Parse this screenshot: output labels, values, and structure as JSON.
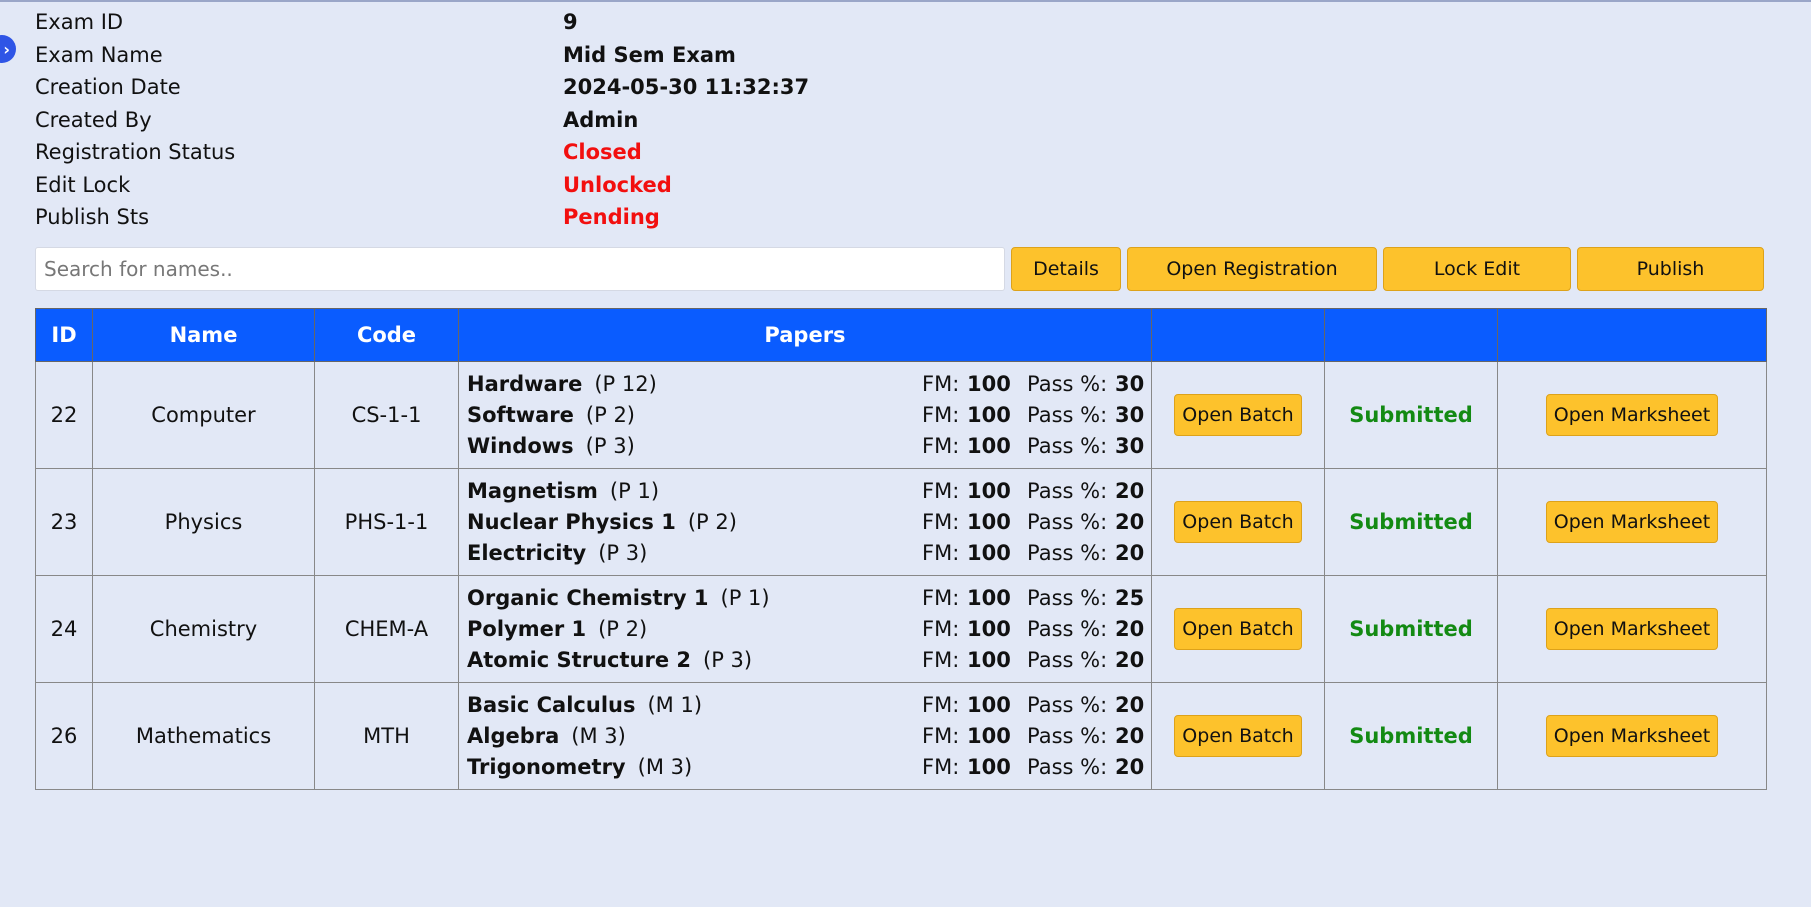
{
  "exam_info": [
    {
      "label": "Exam ID",
      "value": "9",
      "color": "#111111"
    },
    {
      "label": "Exam Name",
      "value": "Mid Sem Exam",
      "color": "#111111"
    },
    {
      "label": "Creation Date",
      "value": "2024-05-30 11:32:37",
      "color": "#111111"
    },
    {
      "label": "Created By",
      "value": "Admin",
      "color": "#111111"
    },
    {
      "label": "Registration Status",
      "value": "Closed",
      "color": "#f20f0f"
    },
    {
      "label": "Edit Lock",
      "value": "Unlocked",
      "color": "#f20f0f"
    },
    {
      "label": "Publish Sts",
      "value": "Pending",
      "color": "#f20f0f"
    }
  ],
  "search": {
    "placeholder": "Search for names.."
  },
  "toolbar": {
    "details_label": "Details",
    "open_registration_label": "Open Registration",
    "lock_edit_label": "Lock Edit",
    "publish_label": "Publish"
  },
  "table": {
    "headers": {
      "id": "ID",
      "name": "Name",
      "code": "Code",
      "papers": "Papers"
    },
    "fm_label": "FM:",
    "pass_label": "Pass %:",
    "rows": [
      {
        "id": "22",
        "name": "Computer",
        "code": "CS-1-1",
        "papers": [
          {
            "name": "Hardware",
            "code": "(P 12)",
            "fm": "100",
            "pass": "30"
          },
          {
            "name": "Software",
            "code": "(P 2)",
            "fm": "100",
            "pass": "30"
          },
          {
            "name": "Windows",
            "code": "(P 3)",
            "fm": "100",
            "pass": "30"
          }
        ],
        "batch_label": "Open Batch",
        "status": "Submitted",
        "marksheet_label": "Open Marksheet"
      },
      {
        "id": "23",
        "name": "Physics",
        "code": "PHS-1-1",
        "papers": [
          {
            "name": "Magnetism",
            "code": "(P 1)",
            "fm": "100",
            "pass": "20"
          },
          {
            "name": "Nuclear Physics 1",
            "code": "(P 2)",
            "fm": "100",
            "pass": "20"
          },
          {
            "name": "Electricity",
            "code": "(P 3)",
            "fm": "100",
            "pass": "20"
          }
        ],
        "batch_label": "Open Batch",
        "status": "Submitted",
        "marksheet_label": "Open Marksheet"
      },
      {
        "id": "24",
        "name": "Chemistry",
        "code": "CHEM-A",
        "papers": [
          {
            "name": "Organic Chemistry 1",
            "code": "(P 1)",
            "fm": "100",
            "pass": "25"
          },
          {
            "name": "Polymer 1",
            "code": "(P 2)",
            "fm": "100",
            "pass": "20"
          },
          {
            "name": "Atomic Structure 2",
            "code": "(P 3)",
            "fm": "100",
            "pass": "20"
          }
        ],
        "batch_label": "Open Batch",
        "status": "Submitted",
        "marksheet_label": "Open Marksheet"
      },
      {
        "id": "26",
        "name": "Mathematics",
        "code": "MTH",
        "papers": [
          {
            "name": "Basic Calculus",
            "code": "(M 1)",
            "fm": "100",
            "pass": "20"
          },
          {
            "name": "Algebra",
            "code": "(M 3)",
            "fm": "100",
            "pass": "20"
          },
          {
            "name": "Trigonometry",
            "code": "(M 3)",
            "fm": "100",
            "pass": "20"
          }
        ],
        "batch_label": "Open Batch",
        "status": "Submitted",
        "marksheet_label": "Open Marksheet"
      }
    ]
  }
}
